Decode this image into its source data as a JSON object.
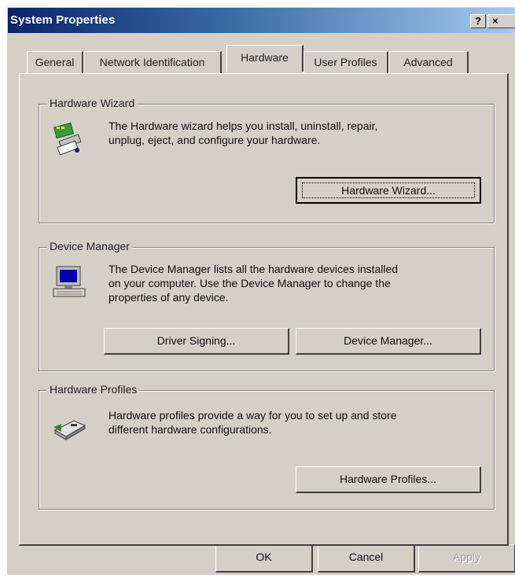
{
  "window": {
    "title": "System Properties",
    "help_button": "?",
    "close_button": "×"
  },
  "tabs": [
    {
      "label": "General",
      "active": false
    },
    {
      "label": "Network Identification",
      "active": false
    },
    {
      "label": "Hardware",
      "active": true
    },
    {
      "label": "User Profiles",
      "active": false
    },
    {
      "label": "Advanced",
      "active": false
    }
  ],
  "groups": {
    "hardware_wizard": {
      "title": "Hardware Wizard",
      "description_line1": "The Hardware wizard helps you install, uninstall, repair,",
      "description_line2": "unplug, eject, and configure your hardware.",
      "button": "Hardware Wizard..."
    },
    "device_manager": {
      "title": "Device Manager",
      "description_line1": "The Device Manager lists all the hardware devices installed",
      "description_line2": "on your computer. Use the Device Manager to change the",
      "description_line3": "properties of any device.",
      "driver_signing_button": "Driver Signing...",
      "device_manager_button": "Device Manager..."
    },
    "hardware_profiles": {
      "title": "Hardware Profiles",
      "description_line1": "Hardware profiles provide a way for you to set up and store",
      "description_line2": "different hardware configurations.",
      "button": "Hardware Profiles..."
    }
  },
  "footer": {
    "ok": "OK",
    "cancel": "Cancel",
    "apply": "Apply",
    "apply_enabled": false
  },
  "icons": {
    "hardware_wizard": "hardware-wizard-icon",
    "device_manager": "computer-icon",
    "hardware_profiles": "hardware-profiles-icon"
  }
}
